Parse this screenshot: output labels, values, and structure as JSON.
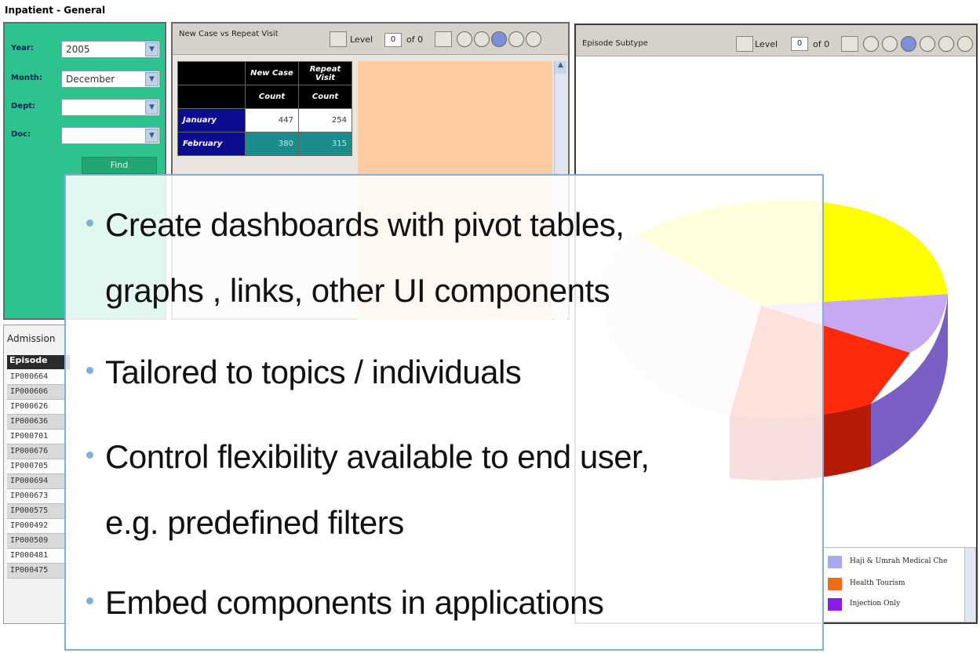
{
  "page_title": "Inpatient - General",
  "filters": {
    "year": {
      "label": "Year:",
      "value": "2005"
    },
    "month": {
      "label": "Month:",
      "value": "December"
    },
    "dept": {
      "label": "Dept:",
      "value": ""
    },
    "doc": {
      "label": "Doc:",
      "value": ""
    },
    "find_label": "Find"
  },
  "pivot_panel": {
    "title": "New Case vs Repeat Visit",
    "level_label": "Level",
    "level_value": "0",
    "of_label": "of 0",
    "columns": [
      "New Case",
      "Repeat Visit"
    ],
    "subheaders": [
      "Count",
      "Count"
    ],
    "rows": [
      {
        "month": "January",
        "new": "447",
        "repeat": "254"
      },
      {
        "month": "February",
        "new": "380",
        "repeat": "315"
      }
    ]
  },
  "episode_panel": {
    "title": "Episode Subtype",
    "level_label": "Level",
    "level_value": "0",
    "of_label": "of 0"
  },
  "legend": [
    {
      "label": "Haji & Umrah Medical Che",
      "color": "#a7a9ef"
    },
    {
      "label": "Health Tourism",
      "color": "#f06a1e"
    },
    {
      "label": "Injection Only",
      "color": "#8a1ee8"
    }
  ],
  "admission": {
    "title": "Admission",
    "header": "Episode",
    "rows": [
      "IP000664",
      "IP000606",
      "IP000626",
      "IP000636",
      "IP000701",
      "IP000676",
      "IP000705",
      "IP000694",
      "IP000673",
      "IP000575",
      "IP000492",
      "IP000509",
      "IP000481",
      "IP000475"
    ]
  },
  "slide_bullets": [
    {
      "line1": "Create dashboards with pivot tables,",
      "line2": "graphs , links, other UI components"
    },
    {
      "line1": "Tailored to topics / individuals",
      "line2": ""
    },
    {
      "line1": "Control flexibility available to end user,",
      "line2": "e.g. predefined filters"
    },
    {
      "line1": "Embed components in applications",
      "line2": ""
    }
  ],
  "colors": {
    "filter_panel": "#2ec28f",
    "bullet": "#7fb0d8",
    "pie_yellow": "#ffff00",
    "pie_lavender": "#c7a8f2",
    "pie_red": "#ff2a0a"
  }
}
